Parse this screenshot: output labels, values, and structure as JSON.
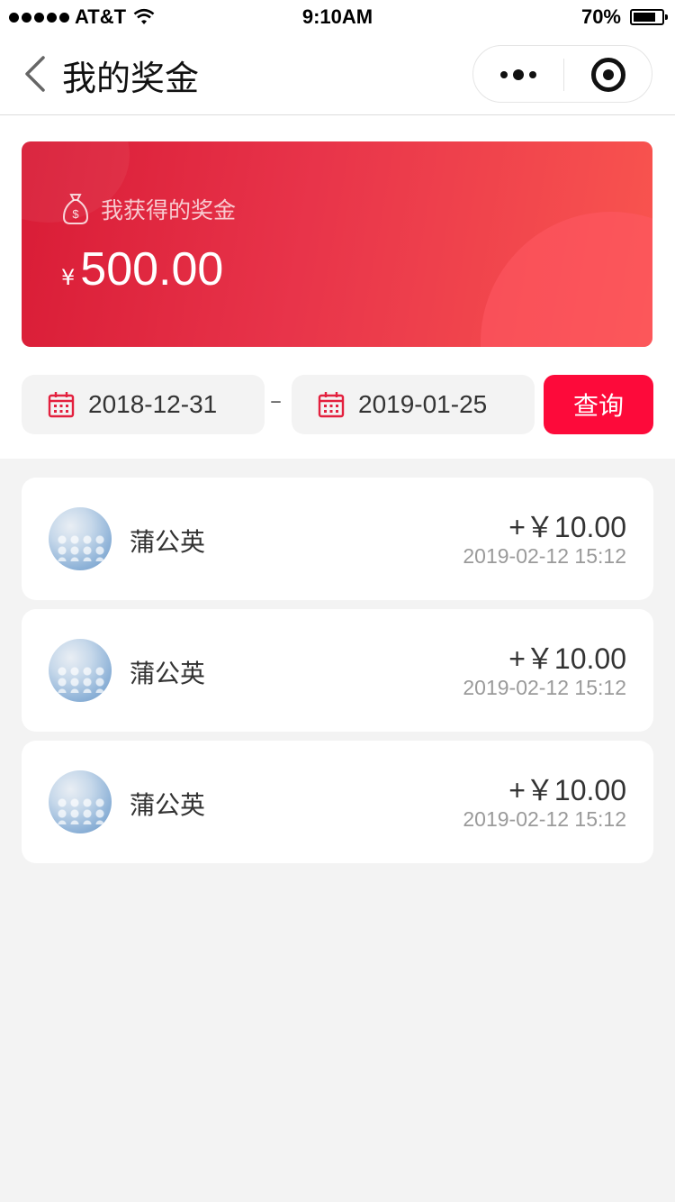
{
  "status_bar": {
    "carrier": "AT&T",
    "time": "9:10AM",
    "battery": "70%",
    "battery_level": 0.7
  },
  "nav": {
    "title": "我的奖金"
  },
  "bonus": {
    "label": "我获得的奖金",
    "currency": "¥",
    "amount": "500.00"
  },
  "filter": {
    "start_date": "2018-12-31",
    "separator": "–",
    "end_date": "2019-01-25",
    "query_label": "查询"
  },
  "records": [
    {
      "name": "蒲公英",
      "amount": "+￥10.00",
      "time": "2019-02-12 15:12"
    },
    {
      "name": "蒲公英",
      "amount": "+￥10.00",
      "time": "2019-02-12 15:12"
    },
    {
      "name": "蒲公英",
      "amount": "+￥10.00",
      "time": "2019-02-12 15:12"
    }
  ],
  "colors": {
    "accent": "#fd0a3a",
    "card_gradient_start": "#d91c36",
    "card_gradient_end": "#f9554f"
  }
}
